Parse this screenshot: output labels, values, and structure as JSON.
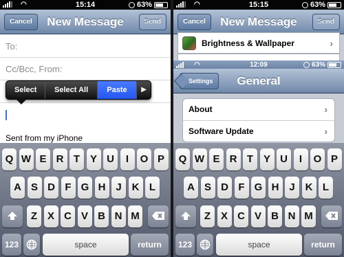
{
  "left": {
    "status": {
      "time": "15:14",
      "battery": "63%"
    },
    "nav": {
      "title": "New Message",
      "cancel": "Cancel",
      "send": "Send"
    },
    "fields": {
      "to": "To:",
      "ccbcc": "Cc/Bcc, From:",
      "subject_partial": "S"
    },
    "callout": {
      "options": [
        "Select",
        "Select All",
        "Paste"
      ],
      "arrow": "▶"
    },
    "body": {
      "signature": "Sent from my iPhone"
    }
  },
  "right": {
    "status": {
      "time": "15:15",
      "battery": "63%"
    },
    "nav": {
      "title": "New Message",
      "cancel": "Cancel",
      "send": "Send"
    },
    "settings_row": {
      "label": "Brightness & Wallpaper",
      "chevron": "›"
    },
    "inset_status": {
      "time": "12:09",
      "battery": "63%"
    },
    "general_nav": {
      "back": "Settings",
      "title": "General"
    },
    "general_rows": [
      {
        "label": "About",
        "chevron": "›"
      },
      {
        "label": "Software Update",
        "chevron": "›"
      }
    ]
  },
  "keyboard": {
    "row1": [
      "Q",
      "W",
      "E",
      "R",
      "T",
      "Y",
      "U",
      "I",
      "O",
      "P"
    ],
    "row2": [
      "A",
      "S",
      "D",
      "F",
      "G",
      "H",
      "J",
      "K",
      "L"
    ],
    "row3": [
      "Z",
      "X",
      "C",
      "V",
      "B",
      "N",
      "M"
    ],
    "numbers": "123",
    "space": "space",
    "return": "return",
    "shift_icon": "shift-arrow-icon",
    "delete_icon": "backspace-icon",
    "globe_icon": "globe-icon"
  }
}
